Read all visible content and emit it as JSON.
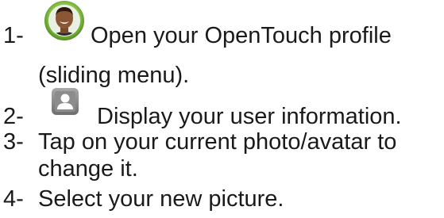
{
  "steps": [
    {
      "number": "1-",
      "icon": "user-photo-avatar-icon",
      "line1": "Open your OpenTouch profile",
      "line2": "(sliding menu)."
    },
    {
      "number": "2-",
      "icon": "contact-card-icon",
      "line1": "Display your user information."
    },
    {
      "number": "3-",
      "line1": "Tap on your current photo/avatar to",
      "line2": "change it."
    },
    {
      "number": "4-",
      "line1": "Select your new picture."
    }
  ],
  "colors": {
    "text": "#1a1a1a",
    "avatar_ring": "#8bc34a",
    "contact_icon_bg": "#8a8a8a"
  }
}
